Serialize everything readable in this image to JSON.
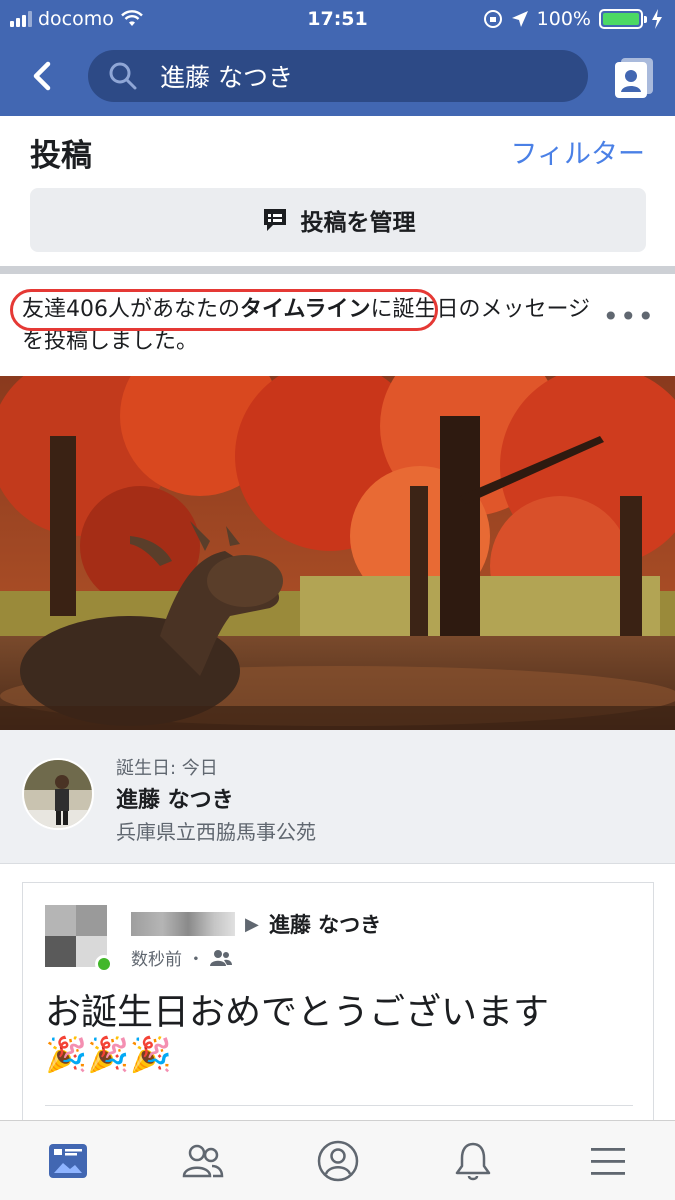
{
  "status_bar": {
    "carrier": "docomo",
    "time": "17:51",
    "battery": "100%",
    "battery_level": 1.0,
    "signal_bars": 3
  },
  "nav": {
    "search_text": "進藤 なつき",
    "back_icon": "back-chevron-icon",
    "search_icon": "search-icon",
    "profile_icon": "profile-card-icon"
  },
  "posts_section": {
    "title": "投稿",
    "filter_label": "フィルター",
    "manage_label": "投稿を管理",
    "manage_icon": "speech-bubble-icon"
  },
  "post": {
    "text_part1": "友達406人があなたの",
    "text_bold": "タイムライン",
    "text_part2": "に誕生日のメッセージを投稿しました。",
    "highlight_color": "#e53935"
  },
  "birthday_card": {
    "label": "誕生日: 今日",
    "name": "進藤 なつき",
    "place": "兵庫県立西脇馬事公苑"
  },
  "comment": {
    "arrow": "▶",
    "recipient": "進藤 なつき",
    "time": "数秒前 ・",
    "audience_icon": "friends-icon",
    "message": "お誕生日おめでとうございます",
    "emoji": "🎉🎉🎉"
  },
  "tabbar": [
    {
      "icon": "news-feed-icon",
      "active": true
    },
    {
      "icon": "friends-icon",
      "active": false
    },
    {
      "icon": "profile-icon",
      "active": false
    },
    {
      "icon": "notifications-bell-icon",
      "active": false
    },
    {
      "icon": "menu-icon",
      "active": false
    }
  ],
  "colors": {
    "brand": "#4267b2",
    "link": "#4a80e6",
    "online": "#42b72a"
  }
}
